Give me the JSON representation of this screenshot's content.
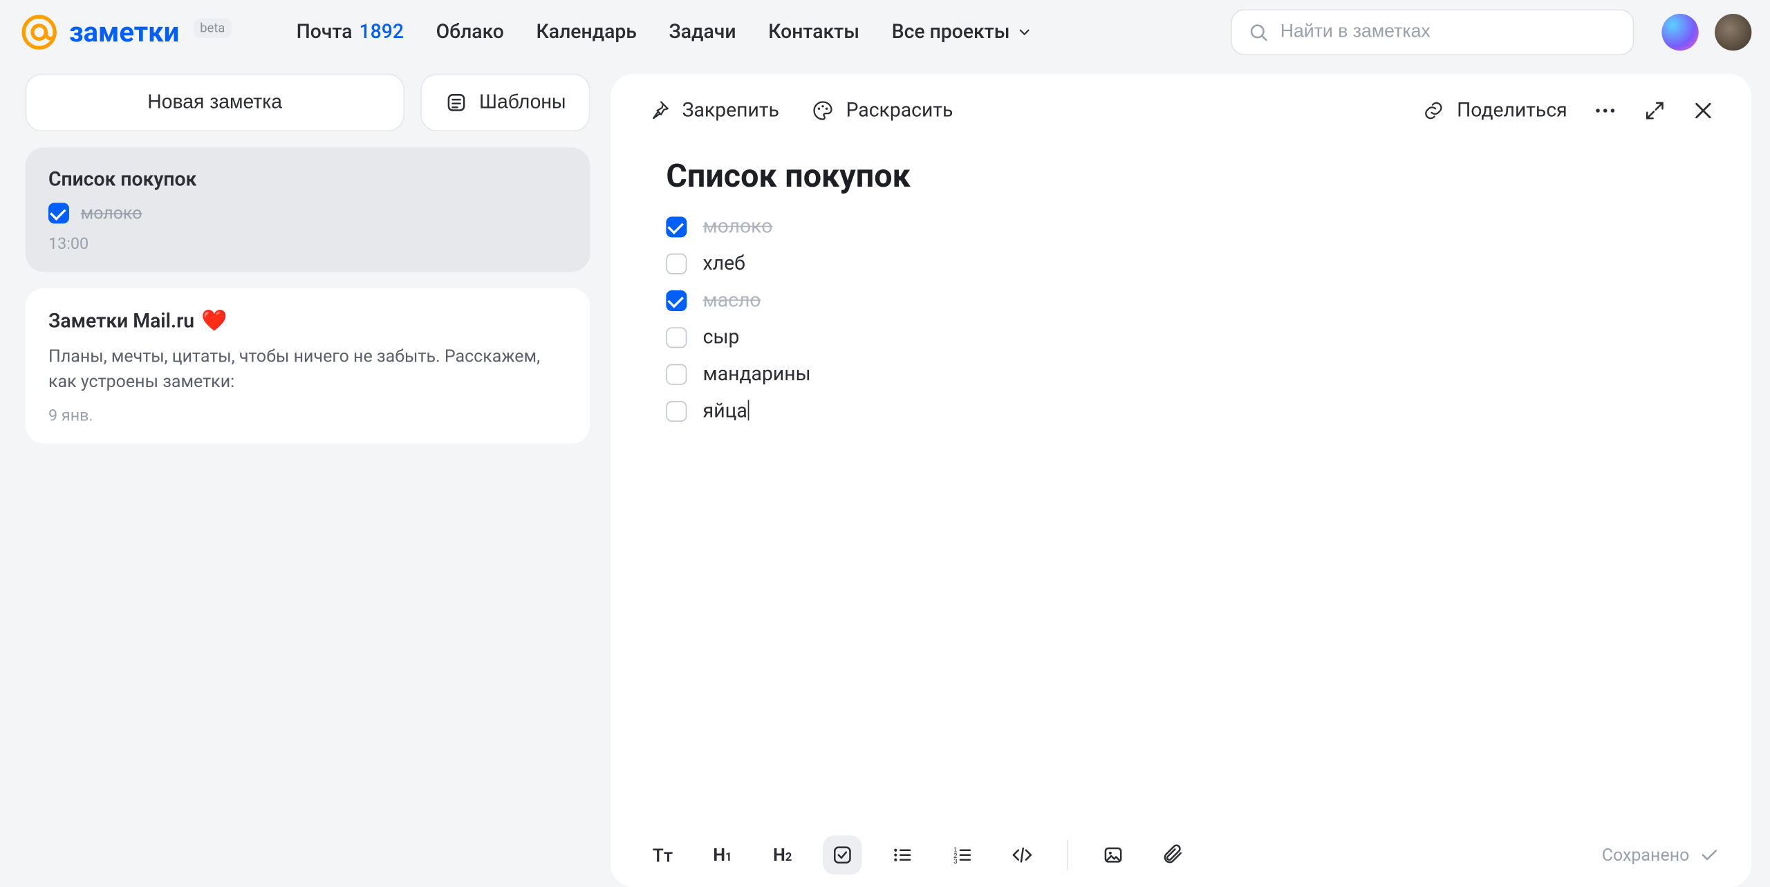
{
  "header": {
    "product": "заметки",
    "beta": "beta",
    "nav": {
      "mail": "Почта",
      "mail_count": "1892",
      "cloud": "Облако",
      "calendar": "Календарь",
      "tasks": "Задачи",
      "contacts": "Контакты",
      "projects": "Все проекты"
    },
    "search_placeholder": "Найти в заметках"
  },
  "sidebar": {
    "new_note": "Новая заметка",
    "templates": "Шаблоны",
    "notes": [
      {
        "title": "Список покупок",
        "preview": "молоко",
        "preview_done": true,
        "time": "13:00",
        "selected": true
      },
      {
        "title": "Заметки Mail.ru",
        "heart": "❤️",
        "body": "Планы, мечты, цитаты, чтобы ничего не забыть. Расскажем, как устроены заметки:",
        "time": "9 янв."
      }
    ]
  },
  "editor": {
    "actions": {
      "pin": "Закрепить",
      "color": "Раскрасить",
      "share": "Поделиться"
    },
    "title": "Список покупок",
    "items": [
      {
        "text": "молоко",
        "done": true
      },
      {
        "text": "хлеб",
        "done": false
      },
      {
        "text": "масло",
        "done": true
      },
      {
        "text": "сыр",
        "done": false
      },
      {
        "text": "мандарины",
        "done": false
      },
      {
        "text": "яйца",
        "done": false,
        "cursor": true
      }
    ],
    "saved": "Сохранено"
  }
}
